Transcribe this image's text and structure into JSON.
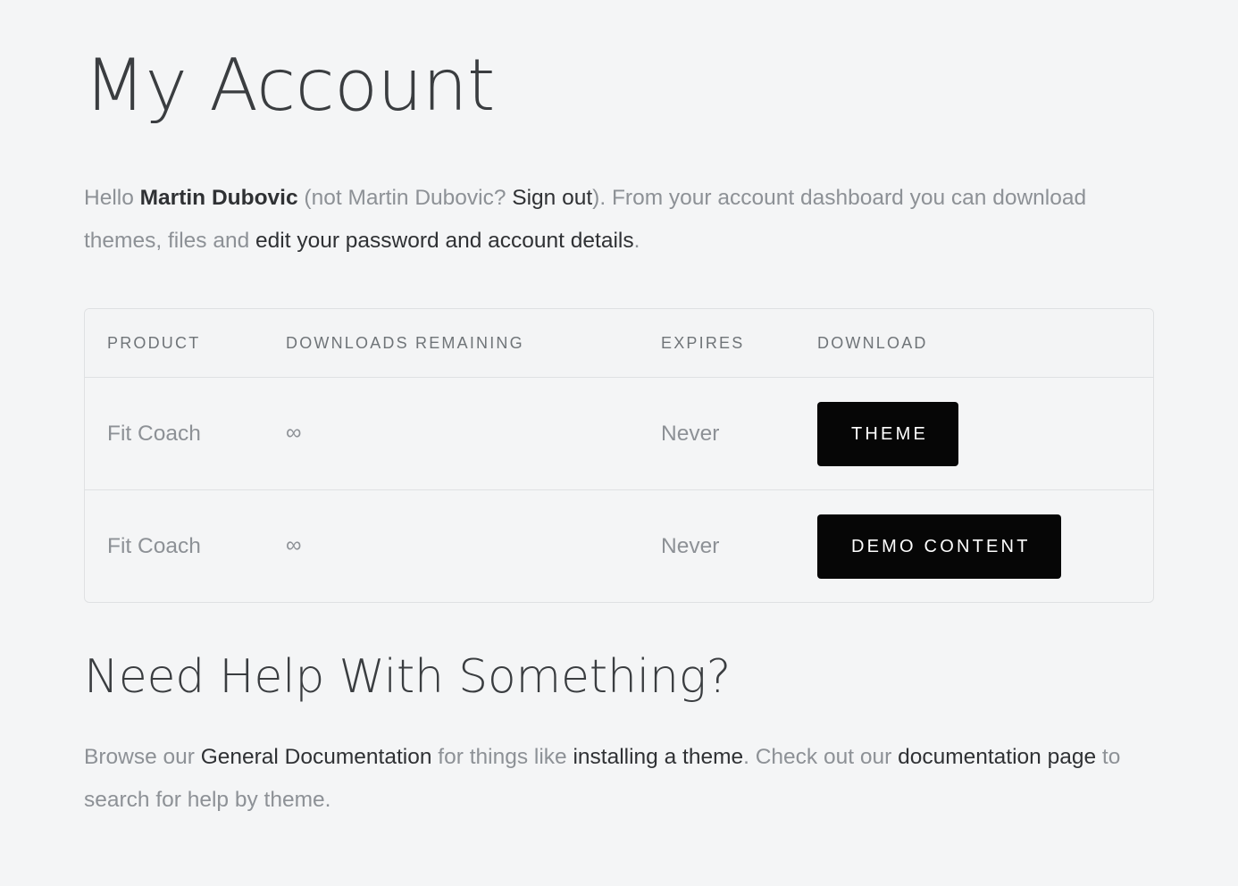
{
  "page": {
    "title": "My Account",
    "background_color": "#f4f5f6",
    "accent_color": "#060606",
    "text_color": "#8d9196",
    "link_color": "#2f3134"
  },
  "intro": {
    "greeting_prefix": "Hello ",
    "user_name": "Martin Dubovic",
    "not_you_prefix": " (not Martin Dubovic? ",
    "sign_out_label": "Sign out",
    "after_sign_out": "). From your account dashboard you can download themes, files and ",
    "edit_details_label": "edit your password and account details",
    "intro_suffix": "."
  },
  "downloads_table": {
    "columns": [
      "PRODUCT",
      "DOWNLOADS REMAINING",
      "EXPIRES",
      "DOWNLOAD"
    ],
    "rows": [
      {
        "product": "Fit Coach",
        "downloads_remaining": "∞",
        "expires": "Never",
        "download_label": "THEME"
      },
      {
        "product": "Fit Coach",
        "downloads_remaining": "∞",
        "expires": "Never",
        "download_label": "DEMO CONTENT"
      }
    ]
  },
  "help": {
    "title": "Need Help With Something?",
    "prefix": "Browse our ",
    "general_docs_label": "General Documentation",
    "middle_1": " for things like ",
    "installing_theme_label": "installing a theme",
    "middle_2": ". Check out our ",
    "documentation_page_label": "documentation page",
    "suffix": " to search for help by theme."
  }
}
